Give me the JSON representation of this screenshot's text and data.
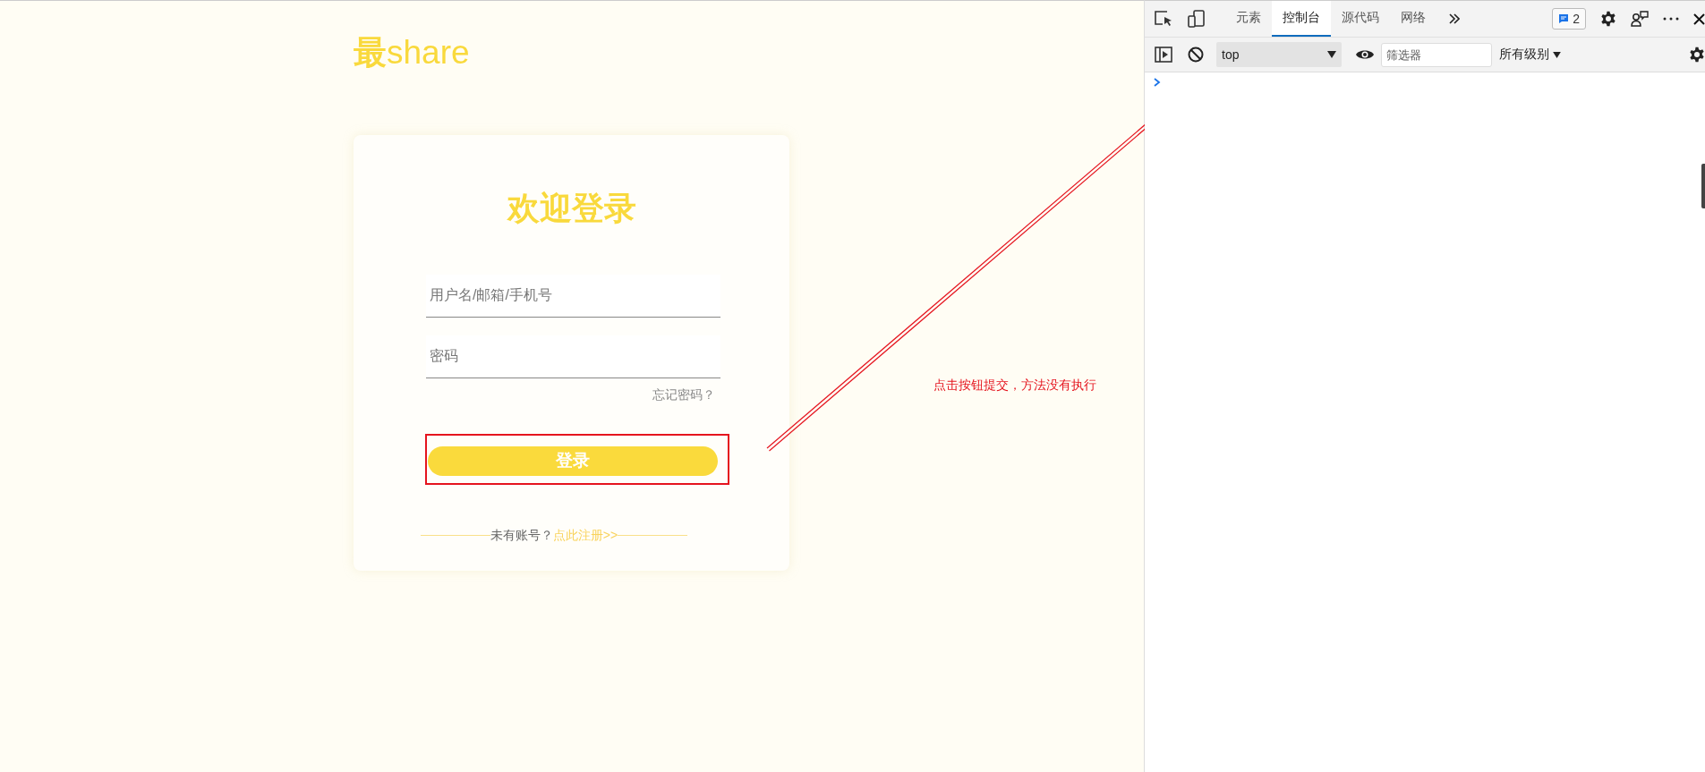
{
  "site": {
    "logo": "**最**share"
  },
  "login_card": {
    "title": "欢迎登录",
    "fields": [
      {
        "placeholder": "用户名/邮箱/手机号"
      },
      {
        "placeholder": "密码"
      }
    ],
    "forgot_link": "忘记密码？",
    "submit_button": "登录",
    "signup_prompt": "未有账号？",
    "signup_link": "点此注册>>"
  },
  "annotation": {
    "text": "点击按钮提交，方法没有执行"
  },
  "devtools": {
    "tabs": [
      {
        "label": "元素",
        "selected": false
      },
      {
        "label": "控制台",
        "selected": true
      },
      {
        "label": "源代码",
        "selected": false
      },
      {
        "label": "网络",
        "selected": false
      }
    ],
    "issues_badge": "2",
    "context_select": "top",
    "filter": {
      "placeholder": "筛选器"
    },
    "level_select": "所有级别"
  }
}
